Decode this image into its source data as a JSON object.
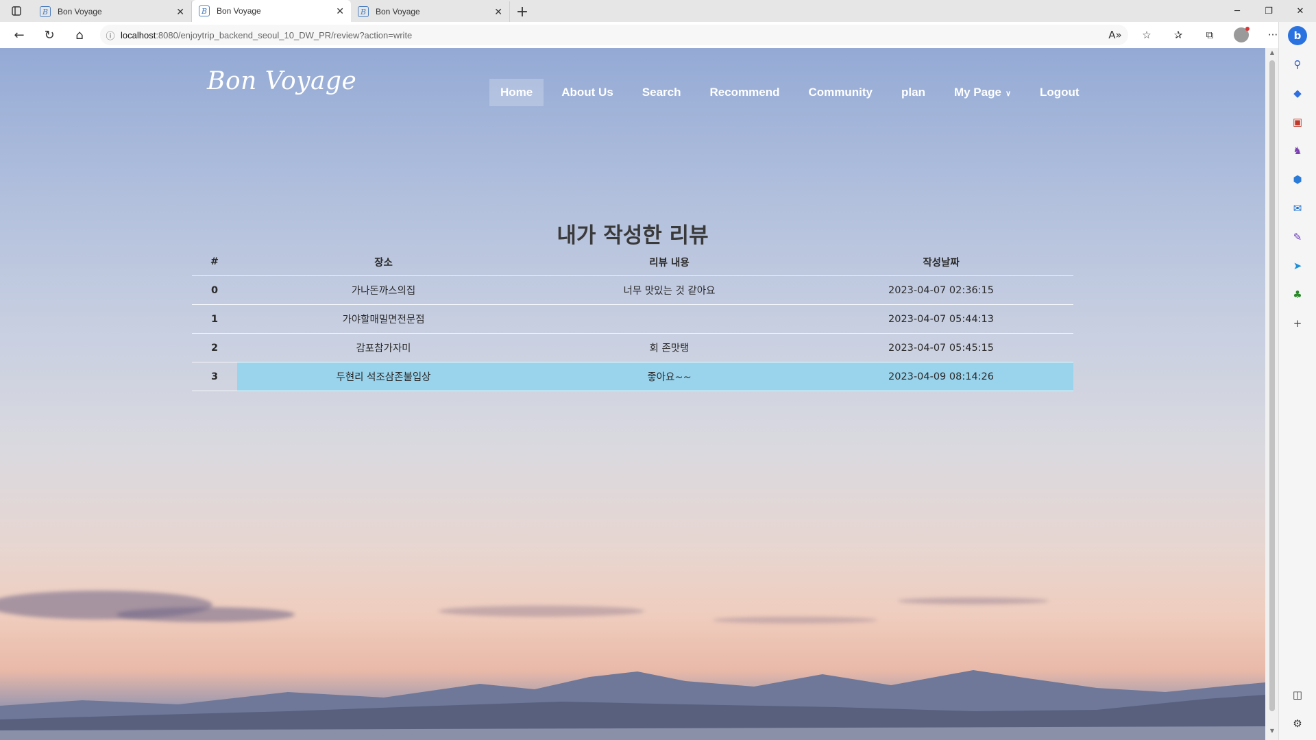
{
  "browser": {
    "tabs": [
      {
        "title": "Bon Voyage",
        "favicon": "B"
      },
      {
        "title": "Bon Voyage",
        "favicon": "B"
      },
      {
        "title": "Bon Voyage",
        "favicon": "B"
      }
    ],
    "url_host": "localhost",
    "url_path": ":8080/enjoytrip_backend_seoul_10_DW_PR/review?action=write"
  },
  "site": {
    "logo": "Bon Voyage",
    "nav": {
      "home": "Home",
      "about": "About Us",
      "search": "Search",
      "recommend": "Recommend",
      "community": "Community",
      "plan": "plan",
      "mypage": "My Page",
      "logout": "Logout"
    }
  },
  "reviews": {
    "title": "내가 작성한 리뷰",
    "headers": {
      "index": "#",
      "place": "장소",
      "content": "리뷰 내용",
      "date": "작성날짜"
    },
    "rows": [
      {
        "index": "0",
        "place": "가나돈까스의집",
        "content": "너무 맛있는 것 같아요",
        "date": "2023-04-07 02:36:15"
      },
      {
        "index": "1",
        "place": "가야할매밀면전문점",
        "content": "",
        "date": "2023-04-07 05:44:13"
      },
      {
        "index": "2",
        "place": "감포참가자미",
        "content": "회 존맛탱",
        "date": "2023-04-07 05:45:15"
      },
      {
        "index": "3",
        "place": "두현리 석조삼존불입상",
        "content": "좋아요~~",
        "date": "2023-04-09 08:14:26"
      }
    ],
    "highlight_color": "#99d3ec"
  }
}
